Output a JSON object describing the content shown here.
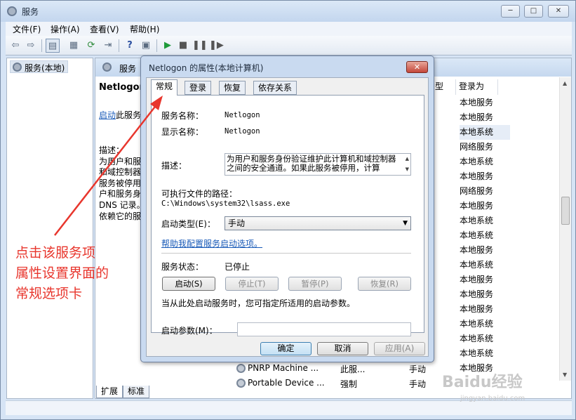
{
  "window": {
    "title": "服务",
    "min": "─",
    "max": "□",
    "close": "✕"
  },
  "menu": [
    "文件(F)",
    "操作(A)",
    "查看(V)",
    "帮助(H)"
  ],
  "toolbar_icons": [
    "back-icon",
    "forward-icon",
    "console-tree-icon",
    "properties-icon",
    "refresh-icon",
    "export-icon",
    "help-icon",
    "view-icon",
    "play-icon",
    "stop-icon",
    "pause-icon",
    "restart-icon"
  ],
  "tree": {
    "root": "服务(本地)"
  },
  "right": {
    "header_title": "服务",
    "service_name": "Netlogon",
    "start_link": "启动",
    "start_suffix": "此服务",
    "desc_lines": [
      "描述：",
      "为用户和服",
      "和域控制器",
      "服务被停用",
      "户和服务身",
      "DNS 记录。",
      "依赖它的服"
    ],
    "col_type": "型",
    "col_logon": "登录为",
    "logon_values": [
      "本地服务",
      "本地服务",
      "本地系统",
      "网络服务",
      "本地系统",
      "本地服务",
      "网络服务",
      "本地服务",
      "本地系统",
      "本地系统",
      "本地服务",
      "本地系统",
      "本地服务",
      "本地服务",
      "本地服务",
      "本地系统",
      "本地系统",
      "本地系统",
      "本地服务"
    ],
    "row_pnrp": {
      "name": "PNRP Machine ...",
      "desc": "此服...",
      "type": "手动"
    },
    "row_portable": {
      "name": "Portable Device ...",
      "desc": "强制",
      "type": "手动"
    }
  },
  "bottom_tabs": [
    "扩展",
    "标准"
  ],
  "dialog": {
    "title": "Netlogon 的属性(本地计算机)",
    "close": "✕",
    "tabs": [
      "常规",
      "登录",
      "恢复",
      "依存关系"
    ],
    "service_name_label": "服务名称：",
    "service_name_value": "Netlogon",
    "display_name_label": "显示名称：",
    "display_name_value": "Netlogon",
    "description_label": "描述：",
    "description_text": "为用户和服务身份验证维护此计算机和域控制器之间的安全通道。如果此服务被停用，计算",
    "path_label": "可执行文件的路径：",
    "path_value": "C:\\Windows\\system32\\lsass.exe",
    "startup_type_label": "启动类型(E)：",
    "startup_type_value": "手动",
    "help_link": "帮助我配置服务启动选项。",
    "status_label": "服务状态：",
    "status_value": "已停止",
    "btn_start": "启动(S)",
    "btn_stop": "停止(T)",
    "btn_pause": "暂停(P)",
    "btn_resume": "恢复(R)",
    "hint": "当从此处启动服务时，您可指定所适用的启动参数。",
    "params_label": "启动参数(M)：",
    "params_value": "",
    "btn_ok": "确定",
    "btn_cancel": "取消",
    "btn_apply": "应用(A)"
  },
  "annotation": {
    "lines": [
      "点击该服务项",
      "属性设置界面的",
      "常规选项卡"
    ],
    "color": "#e8362d"
  },
  "watermark": {
    "text": "Baidu经验",
    "sub": "jingyan.baidu.com"
  }
}
